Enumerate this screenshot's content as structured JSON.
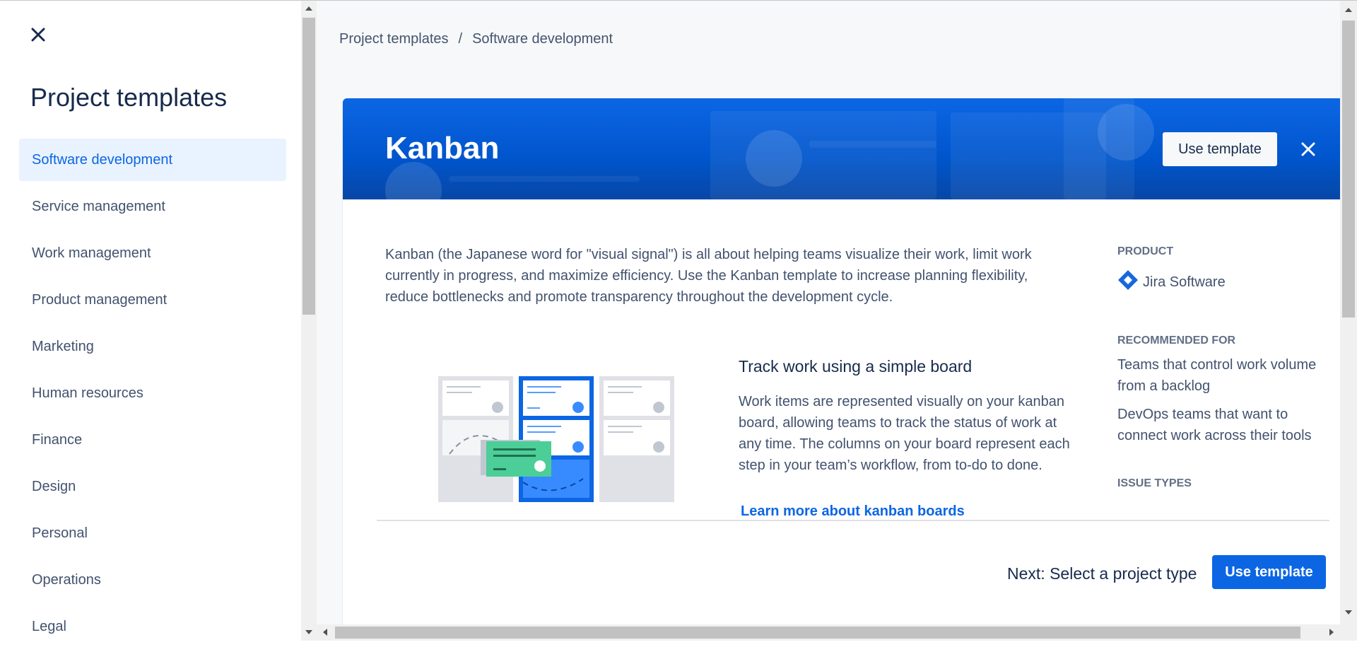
{
  "sidebar": {
    "title": "Project templates",
    "close_icon": "close-icon",
    "items": [
      {
        "label": "Software development",
        "active": true
      },
      {
        "label": "Service management",
        "active": false
      },
      {
        "label": "Work management",
        "active": false
      },
      {
        "label": "Product management",
        "active": false
      },
      {
        "label": "Marketing",
        "active": false
      },
      {
        "label": "Human resources",
        "active": false
      },
      {
        "label": "Finance",
        "active": false
      },
      {
        "label": "Design",
        "active": false
      },
      {
        "label": "Personal",
        "active": false
      },
      {
        "label": "Operations",
        "active": false
      },
      {
        "label": "Legal",
        "active": false
      }
    ]
  },
  "breadcrumb": {
    "root": "Project templates",
    "separator": "/",
    "current": "Software development"
  },
  "template": {
    "name": "Kanban",
    "use_template_label": "Use template",
    "description": "Kanban (the Japanese word for \"visual signal\") is all about helping teams visualize their work, limit work currently in progress, and maximize efficiency. Use the Kanban template to increase planning flexibility, reduce bottlenecks and promote transparency throughout the development cycle.",
    "feature": {
      "title": "Track work using a simple board",
      "text": "Work items are represented visually on your kanban board, allowing teams to track the status of work at any time. The columns on your board represent each step in your team’s workflow, from to-do to done.",
      "link": "Learn more about kanban boards"
    },
    "info": {
      "product_label": "PRODUCT",
      "product_name": "Jira Software",
      "product_icon": "jira-diamond-icon",
      "recommended_label": "RECOMMENDED FOR",
      "recommended": [
        "Teams that control work volume from a backlog",
        "DevOps teams that want to connect work across their tools"
      ],
      "issue_types_label": "ISSUE TYPES"
    }
  },
  "footer": {
    "next_label": "Next: Select a project type",
    "use_template_label": "Use template"
  },
  "colors": {
    "accent": "#0c66e4",
    "banner": "#0055cc",
    "active_nav_bg": "#e9f2ff",
    "text": "#172b4d",
    "subtle_text": "#42526e"
  }
}
